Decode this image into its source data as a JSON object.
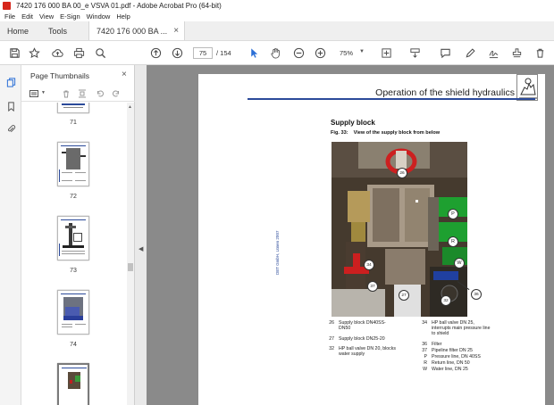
{
  "window": {
    "title": "7420 176 000 BA 00_e VSVA 01.pdf - Adobe Acrobat Pro (64-bit)"
  },
  "menu": [
    "File",
    "Edit",
    "View",
    "E-Sign",
    "Window",
    "Help"
  ],
  "tabs": {
    "home": "Home",
    "tools": "Tools",
    "document": "7420 176 000 BA ...",
    "close": "×"
  },
  "toolbar": {
    "page_current": "75",
    "page_total": "/ 154",
    "zoom": "75%"
  },
  "panel": {
    "title": "Page Thumbnails",
    "close": "×",
    "thumbnails": [
      {
        "label": "71"
      },
      {
        "label": "72"
      },
      {
        "label": "73"
      },
      {
        "label": "74"
      },
      {
        "label": ""
      }
    ]
  },
  "page": {
    "header_title": "Operation of the shield hydraulics",
    "section_title": "Supply block",
    "figure_caption_num": "Fig. 33:",
    "figure_caption": "View of the supply block from below",
    "side_note": "DBT GmbH, Lünen 2007",
    "photo_callouts": [
      {
        "n": "26"
      },
      {
        "n": "P"
      },
      {
        "n": "R"
      },
      {
        "n": "34"
      },
      {
        "n": "W"
      },
      {
        "n": "37"
      },
      {
        "n": "27"
      },
      {
        "n": "32"
      },
      {
        "n": "36"
      }
    ],
    "legend_left": [
      {
        "num": "26",
        "text": "Supply block DN40SS-DN50"
      },
      {
        "num": "27",
        "text": "Supply block DN25-20"
      },
      {
        "num": "32",
        "text": "HP ball valve DN 20, blocks water supply"
      }
    ],
    "legend_right": [
      {
        "num": "34",
        "text": "HP ball valve DN 25, interrupts main pressure line to shield"
      },
      {
        "num": "36",
        "text": "Filter"
      },
      {
        "num": "37",
        "text": "Pipeline filter DN 25"
      },
      {
        "num": "P",
        "text": "Pressure line, DN 40SS"
      },
      {
        "num": "R",
        "text": "Return line, DN 50"
      },
      {
        "num": "W",
        "text": "Water line, DN 25"
      }
    ]
  },
  "colors": {
    "accent": "#2b4a9a",
    "acrobat_red": "#d6261b",
    "canvas_bg": "#8a8a8a"
  }
}
